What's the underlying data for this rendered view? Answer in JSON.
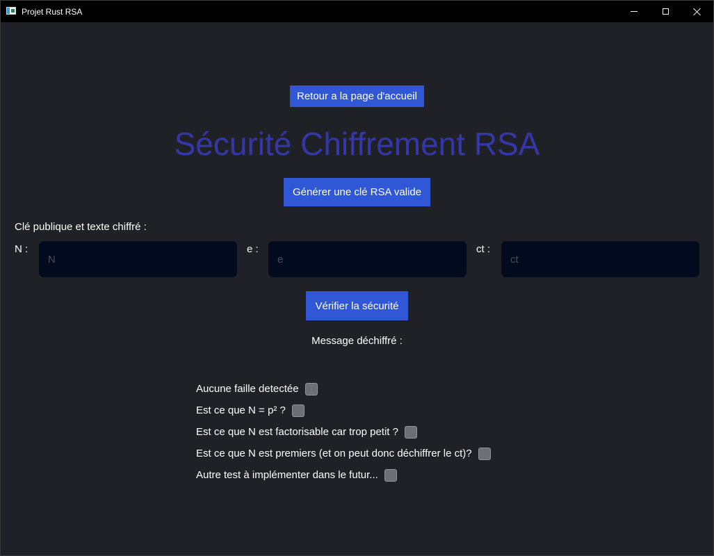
{
  "window": {
    "title": "Projet Rust RSA"
  },
  "nav": {
    "home_button": "Retour a la page d'accueil"
  },
  "page": {
    "title": "Sécurité Chiffrement RSA"
  },
  "actions": {
    "generate_button": "Générer une clé RSA valide",
    "verify_button": "Vérifier la sécurité"
  },
  "inputs": {
    "section_label": "Clé publique et texte chiffré :",
    "n": {
      "label": "N :",
      "placeholder": "N",
      "value": ""
    },
    "e": {
      "label": "e :",
      "placeholder": "e",
      "value": ""
    },
    "ct": {
      "label": "ct :",
      "placeholder": "ct",
      "value": ""
    }
  },
  "result": {
    "decrypted_label": "Message déchiffré :"
  },
  "checks": [
    {
      "label": "Aucune faille detectée",
      "checked": false
    },
    {
      "label": "Est ce que N = p² ?",
      "checked": false
    },
    {
      "label": "Est ce que N est factorisable car trop petit ?",
      "checked": false
    },
    {
      "label": "Est ce que N est premiers (et on peut donc déchiffrer le ct)?",
      "checked": false
    },
    {
      "label": "Autre test à implémenter dans le futur...",
      "checked": false
    }
  ],
  "colors": {
    "background": "#202126",
    "button": "#2f57d6",
    "title": "#3437a7",
    "input_background": "#020a1e",
    "checkbox": "#6e6f73"
  }
}
